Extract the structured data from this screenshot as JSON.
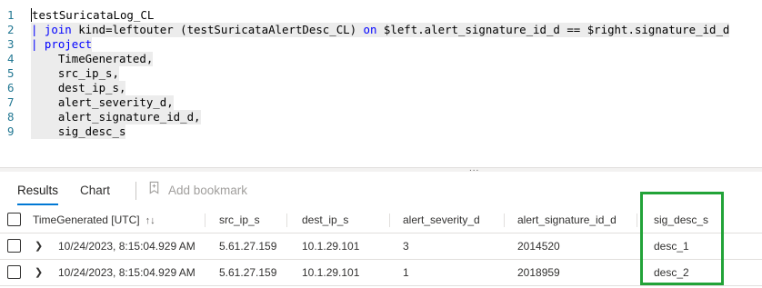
{
  "editor": {
    "lines": [
      {
        "num": "1",
        "parts": [
          {
            "t": "testSuricataLog_CL",
            "c": "var"
          }
        ]
      },
      {
        "num": "2",
        "parts": [
          {
            "t": "| ",
            "c": "pipe"
          },
          {
            "t": "join",
            "c": "kw"
          },
          {
            "t": " kind=leftouter (testSuricataAlertDesc_CL) ",
            "c": "var"
          },
          {
            "t": "on",
            "c": "kw"
          },
          {
            "t": " $left.alert_signature_id_d == $right.signature_id_d",
            "c": "var"
          }
        ]
      },
      {
        "num": "3",
        "parts": [
          {
            "t": "| ",
            "c": "pipe"
          },
          {
            "t": "project",
            "c": "kw"
          }
        ]
      },
      {
        "num": "4",
        "parts": [
          {
            "t": "    TimeGenerated,",
            "c": "var"
          }
        ]
      },
      {
        "num": "5",
        "parts": [
          {
            "t": "    src_ip_s,",
            "c": "var"
          }
        ]
      },
      {
        "num": "6",
        "parts": [
          {
            "t": "    dest_ip_s,",
            "c": "var"
          }
        ]
      },
      {
        "num": "7",
        "parts": [
          {
            "t": "    alert_severity_d,",
            "c": "var"
          }
        ]
      },
      {
        "num": "8",
        "parts": [
          {
            "t": "    alert_signature_id_d,",
            "c": "var"
          }
        ]
      },
      {
        "num": "9",
        "parts": [
          {
            "t": "    sig_desc_s",
            "c": "var"
          }
        ]
      }
    ]
  },
  "splitter": {
    "grip": "..."
  },
  "tabs": {
    "results": "Results",
    "chart": "Chart",
    "add_bookmark": "Add bookmark"
  },
  "table": {
    "columns": {
      "time": "TimeGenerated [UTC]",
      "src": "src_ip_s",
      "dest": "dest_ip_s",
      "severity": "alert_severity_d",
      "sigid": "alert_signature_id_d",
      "desc": "sig_desc_s"
    },
    "rows": [
      {
        "time": "10/24/2023, 8:15:04.929 AM",
        "src": "5.61.27.159",
        "dest": "10.1.29.101",
        "severity": "3",
        "sigid": "2014520",
        "desc": "desc_1"
      },
      {
        "time": "10/24/2023, 8:15:04.929 AM",
        "src": "5.61.27.159",
        "dest": "10.1.29.101",
        "severity": "1",
        "sigid": "2018959",
        "desc": "desc_2"
      }
    ]
  },
  "icons": {
    "sort": "sort-arrows-icon",
    "bookmark": "bookmark-icon",
    "expand": "chevron-right-icon"
  },
  "colors": {
    "accent": "#0078d4",
    "highlight_box": "#22a338",
    "keyword": "#0000ff",
    "line_number": "#237893"
  }
}
